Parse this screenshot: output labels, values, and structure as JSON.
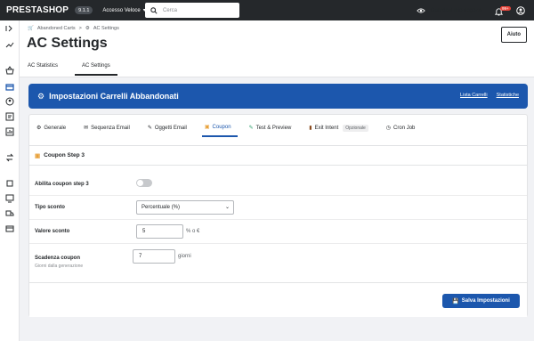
{
  "topbar": {
    "logo": "PRESTASHOP",
    "version": "9.1.1",
    "quick_access": "Accesso Veloce",
    "search_placeholder": "Cerca",
    "view_store": "Guarda il mio negozio",
    "notif_count": "99+"
  },
  "header": {
    "breadcrumb": [
      "Abandoned Carts",
      "AC Settings"
    ],
    "title": "AC Settings",
    "help_label": "Aiuto",
    "tabs": [
      "AC Statistics",
      "AC Settings"
    ]
  },
  "banner": {
    "title": "Impostazioni Carrelli Abbandonati",
    "links": [
      "Lista Carrelli",
      "Statistiche"
    ]
  },
  "card_tabs": [
    {
      "label": "Generale"
    },
    {
      "label": "Sequenza Email"
    },
    {
      "label": "Oggetti Email"
    },
    {
      "label": "Coupon"
    },
    {
      "label": "Test & Preview"
    },
    {
      "label": "Exit Intent"
    },
    {
      "label": "Cron Job"
    }
  ],
  "optional_badge": "Opzionale",
  "section": {
    "title": "Coupon Step 3",
    "enable_label": "Abilita coupon step 3",
    "discount_type_label": "Tipo sconto",
    "discount_type_value": "Percentuale (%)",
    "discount_value_label": "Valore sconto",
    "discount_value": "5",
    "discount_unit": "% o €",
    "expiry_label": "Scadenza coupon",
    "expiry_help": "Giorni dalla generazione",
    "expiry_value": "7",
    "expiry_unit": "giorni"
  },
  "save_label": "Salva Impostazioni",
  "colors": {
    "accent": "#1c57ad",
    "topbar": "#25282b"
  }
}
